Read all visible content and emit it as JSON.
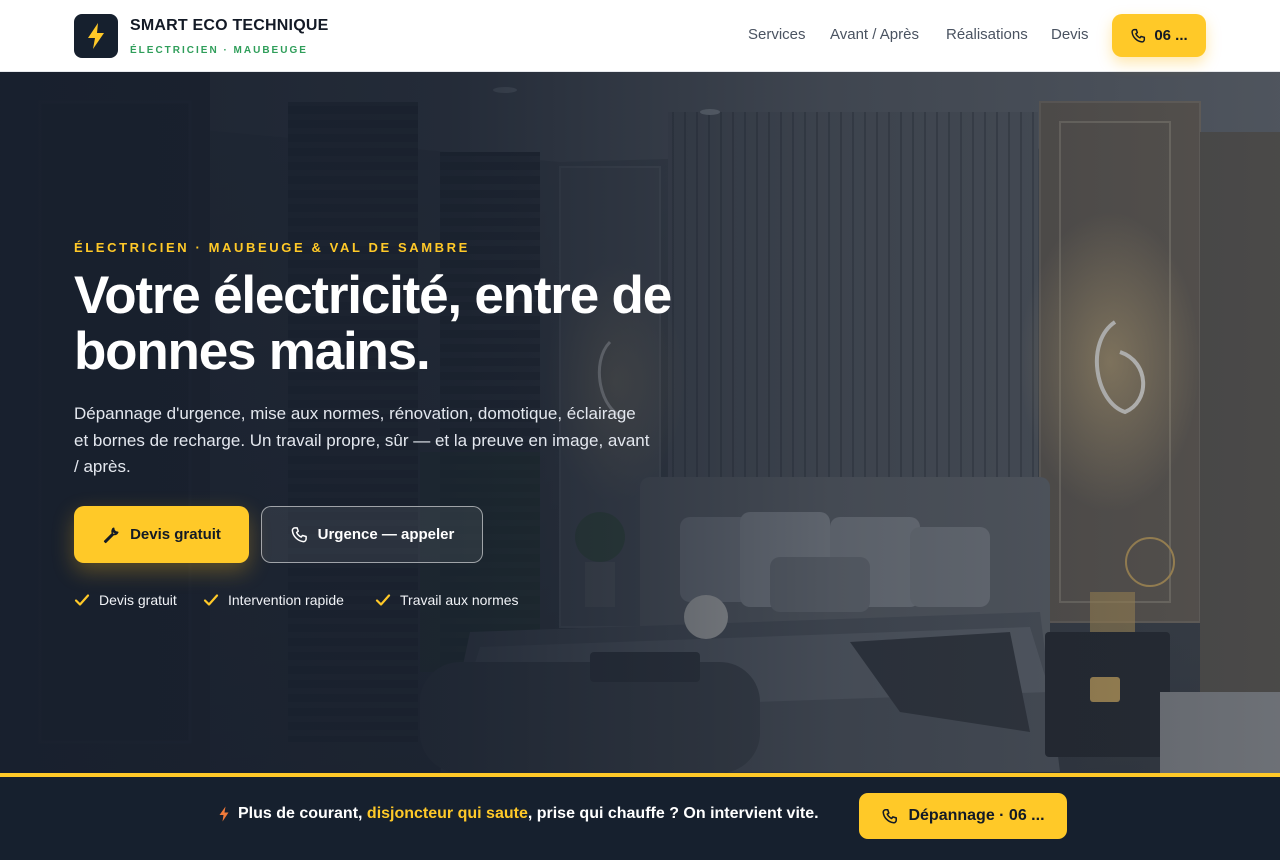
{
  "header": {
    "brand_name": "SMART ECO TECHNIQUE",
    "brand_sub": "ÉLECTRICIEN · MAUBEUGE",
    "nav": [
      "Services",
      "Avant / Après",
      "Réalisations",
      "Devis"
    ],
    "call_label": "06 ..."
  },
  "hero": {
    "eyebrow": "ÉLECTRICIEN · MAUBEUGE & VAL DE SAMBRE",
    "headline": "Votre électricité, entre de bonnes mains.",
    "description": "Dépannage d'urgence, mise aux normes, rénovation, domotique, éclairage et bornes de recharge. Un travail propre, sûr — et la preuve en image, avant / après.",
    "cta_primary": "Devis gratuit",
    "cta_secondary": "Urgence — appeler",
    "features": [
      "Devis gratuit",
      "Intervention rapide",
      "Travail aux normes"
    ]
  },
  "bottom_bar": {
    "text_before": "Plus de courant, ",
    "text_highlight": "disjoncteur qui saute",
    "text_after": ", prise qui chauffe ? On intervient vite.",
    "button_label": "Dépannage · 06 ..."
  },
  "colors": {
    "accent": "#ffc928",
    "navy": "#16202e",
    "brand_green": "#2f9e5a"
  },
  "icons": [
    "lightning-bolt-icon",
    "phone-icon",
    "wrench-icon",
    "check-icon"
  ]
}
